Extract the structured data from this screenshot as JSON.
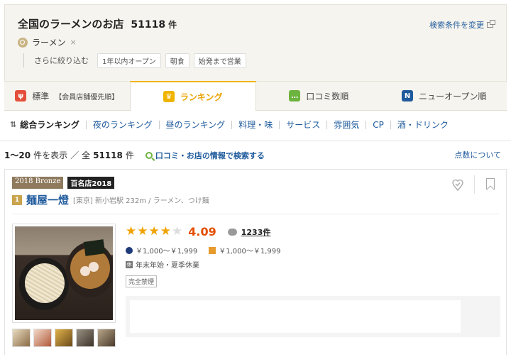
{
  "search": {
    "title": "全国のラーメンのお店",
    "count": "51118",
    "count_unit": "件",
    "change_link": "検索条件を変更",
    "keyword": "ラーメン",
    "keyword_remove": "×",
    "refine_label": "さらに絞り込む",
    "chips": [
      "1年以内オープン",
      "朝食",
      "始発まで営業"
    ]
  },
  "tabs": [
    {
      "label": "標準",
      "sub": "【会員店舗優先順】",
      "icon": "utensils-icon",
      "active": false
    },
    {
      "label": "ランキング",
      "sub": "",
      "icon": "crown-icon",
      "active": true
    },
    {
      "label": "口コミ数順",
      "sub": "",
      "icon": "comment-icon",
      "active": false
    },
    {
      "label": "ニューオープン順",
      "sub": "",
      "icon": "new-icon",
      "active": false
    }
  ],
  "subnav": [
    "総合ランキング",
    "夜のランキング",
    "昼のランキング",
    "料理・味",
    "サービス",
    "雰囲気",
    "CP",
    "酒・ドリンク"
  ],
  "results": {
    "range": "1～20",
    "range_suffix": "件を表示",
    "separator": "／",
    "total_prefix": "全",
    "total": "51118",
    "total_unit": "件",
    "search_reviews": "口コミ・お店の情報で検索する",
    "score_about": "点数について"
  },
  "restaurant": {
    "badge_award": "2018 Bronze",
    "badge_100": "百名店2018",
    "rank": "1",
    "name": "麺屋一燈",
    "area": "[東京] 新小岩駅 232m / ラーメン、つけ麺",
    "rating_value": 4.09,
    "score": "4.09",
    "reviews": "1233件",
    "budget_night": "￥1,000～￥1,999",
    "budget_day": "￥1,000～￥1,999",
    "holiday": "年末年始・夏季休業",
    "smoking": "完全禁煙"
  },
  "colors": {
    "accent": "#f0b400",
    "link": "#1e5a9c",
    "score": "#e34e00"
  }
}
